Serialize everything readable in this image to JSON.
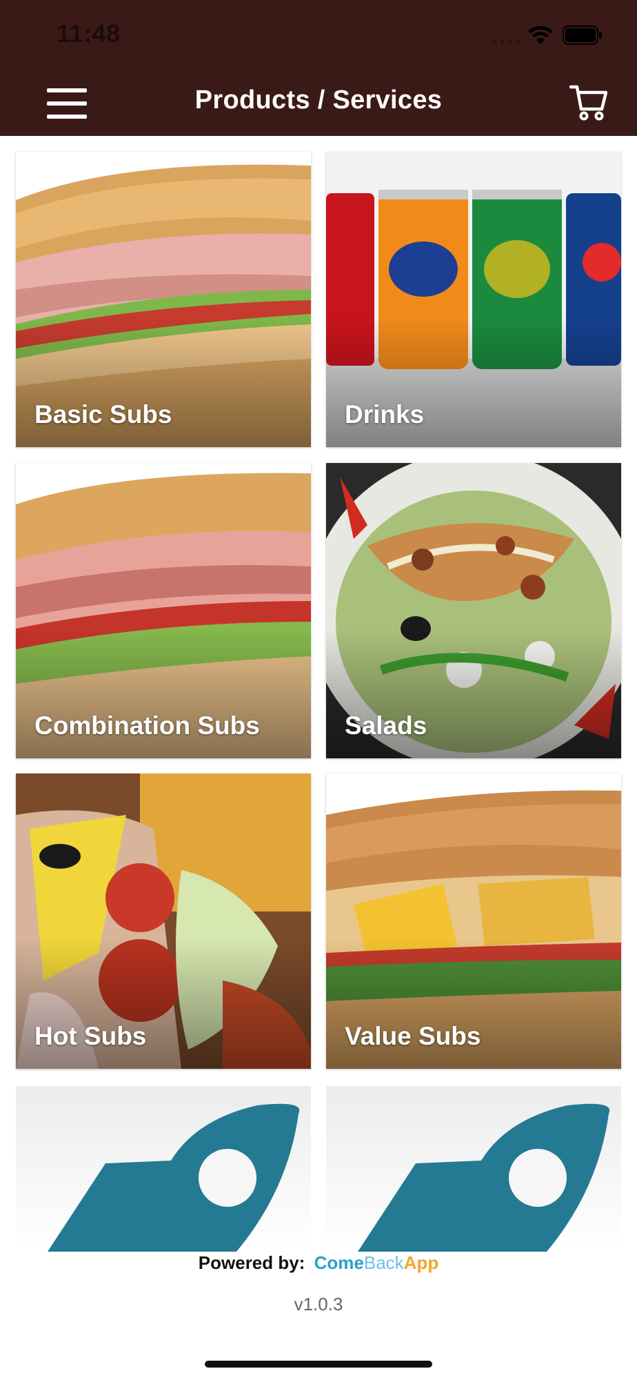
{
  "status_bar": {
    "time": "11:48"
  },
  "header": {
    "title": "Products / Services"
  },
  "products": [
    {
      "label": "Basic Subs"
    },
    {
      "label": "Drinks"
    },
    {
      "label": "Combination Subs"
    },
    {
      "label": "Salads"
    },
    {
      "label": "Hot Subs"
    },
    {
      "label": "Value Subs"
    }
  ],
  "footer": {
    "powered_by": "Powered by:",
    "brand_part1": "Come",
    "brand_part2": "Back",
    "brand_part3": "App",
    "version": "v1.0.3"
  },
  "colors": {
    "header_bg": "#3a1a17",
    "brand_blue": "#2aa0cf",
    "brand_light_blue": "#6cc2e6",
    "brand_orange": "#f5a623",
    "placeholder_icon": "#257a93"
  },
  "icons": [
    "menu-icon",
    "cart-icon",
    "signal-icon",
    "wifi-icon",
    "battery-icon",
    "rocket-placeholder-icon"
  ]
}
